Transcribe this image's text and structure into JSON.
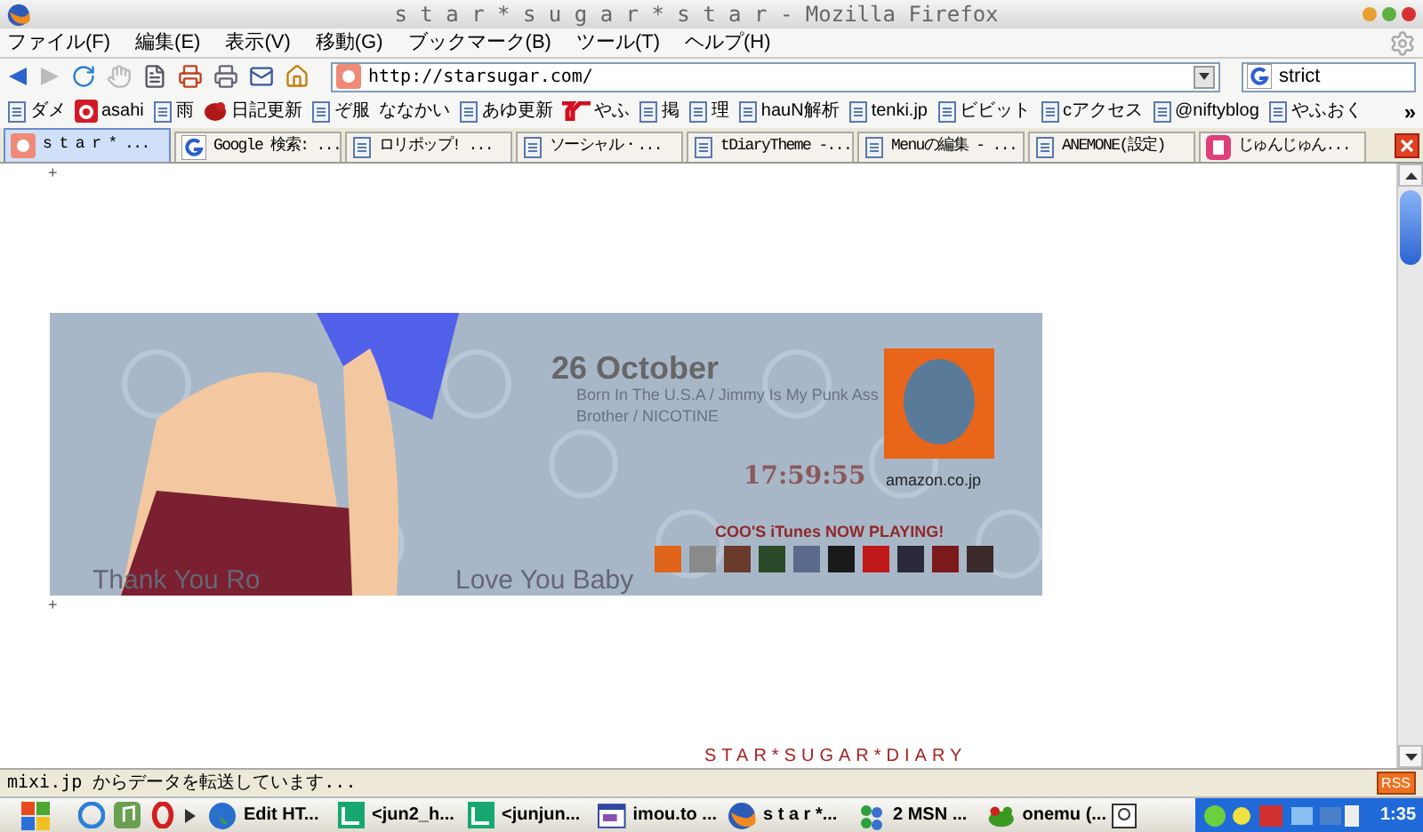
{
  "window": {
    "title": "s t a r * s u g a r * s t a r - Mozilla Firefox"
  },
  "menu": [
    "ファイル(F)",
    "編集(E)",
    "表示(V)",
    "移動(G)",
    "ブックマーク(B)",
    "ツール(T)",
    "ヘルプ(H)"
  ],
  "address": {
    "value": "http://starsugar.com/"
  },
  "search": {
    "value": "strict"
  },
  "bookmarks": [
    {
      "label": "ダメ",
      "kind": "page"
    },
    {
      "label": "asahi",
      "kind": "red"
    },
    {
      "label": "雨",
      "kind": "page"
    },
    {
      "label": "日記更新",
      "kind": "bird"
    },
    {
      "label": "ぞ服",
      "kind": "page"
    },
    {
      "label": "ななかい",
      "kind": "none"
    },
    {
      "label": "あゆ更新",
      "kind": "page"
    },
    {
      "label": "やふ",
      "kind": "yahoo"
    },
    {
      "label": "掲",
      "kind": "page"
    },
    {
      "label": "理",
      "kind": "page"
    },
    {
      "label": "hauN解析",
      "kind": "page"
    },
    {
      "label": "tenki.jp",
      "kind": "page"
    },
    {
      "label": "ビビット",
      "kind": "page"
    },
    {
      "label": "cアクセス",
      "kind": "page"
    },
    {
      "label": "@niftyblog",
      "kind": "page"
    },
    {
      "label": "やふおく",
      "kind": "page"
    }
  ],
  "bookmarks_more": "»",
  "tabs": [
    {
      "label": "s t a r * ...",
      "kind": "site",
      "selected": true
    },
    {
      "label": "Google 検索: ...",
      "kind": "google",
      "selected": false
    },
    {
      "label": "ロリポップ! ...",
      "kind": "page",
      "selected": false
    },
    {
      "label": "ソーシャル・...",
      "kind": "page",
      "selected": false
    },
    {
      "label": "tDiaryTheme -...",
      "kind": "page",
      "selected": false
    },
    {
      "label": "Menuの編集 - ...",
      "kind": "page",
      "selected": false
    },
    {
      "label": "ANEMONE(設定)",
      "kind": "page",
      "selected": false
    },
    {
      "label": "じゅんじゅん...",
      "kind": "pink",
      "selected": false
    }
  ],
  "page": {
    "marks": [
      "+",
      "+"
    ],
    "banner": {
      "date": "26 October",
      "song": "Born In The U.S.A / Jimmy Is My Punk Ass Brother / NICOTINE",
      "time": "17:59:55",
      "store": "amazon.co.jp",
      "playing": "COO'S iTunes NOW PLAYING!",
      "caption_start": "Thank You Ro",
      "caption_end": "Love You Baby"
    },
    "footer_title": "STAR*SUGAR*DIARY"
  },
  "status_bar": {
    "text": "mixi.jp からデータを転送しています...",
    "badge": "RSS"
  },
  "taskbar": {
    "items": [
      {
        "label": "Edit HT...",
        "kind": "globe"
      },
      {
        "label": "<jun2_h...",
        "kind": "green"
      },
      {
        "label": "<junjun...",
        "kind": "green"
      },
      {
        "label": "imou.to ...",
        "kind": "window"
      },
      {
        "label": "s t a r *...",
        "kind": "firefox"
      },
      {
        "label": "2 MSN ...",
        "kind": "msn"
      },
      {
        "label": "onemu (...",
        "kind": "frog"
      }
    ],
    "clock": "1:35"
  }
}
